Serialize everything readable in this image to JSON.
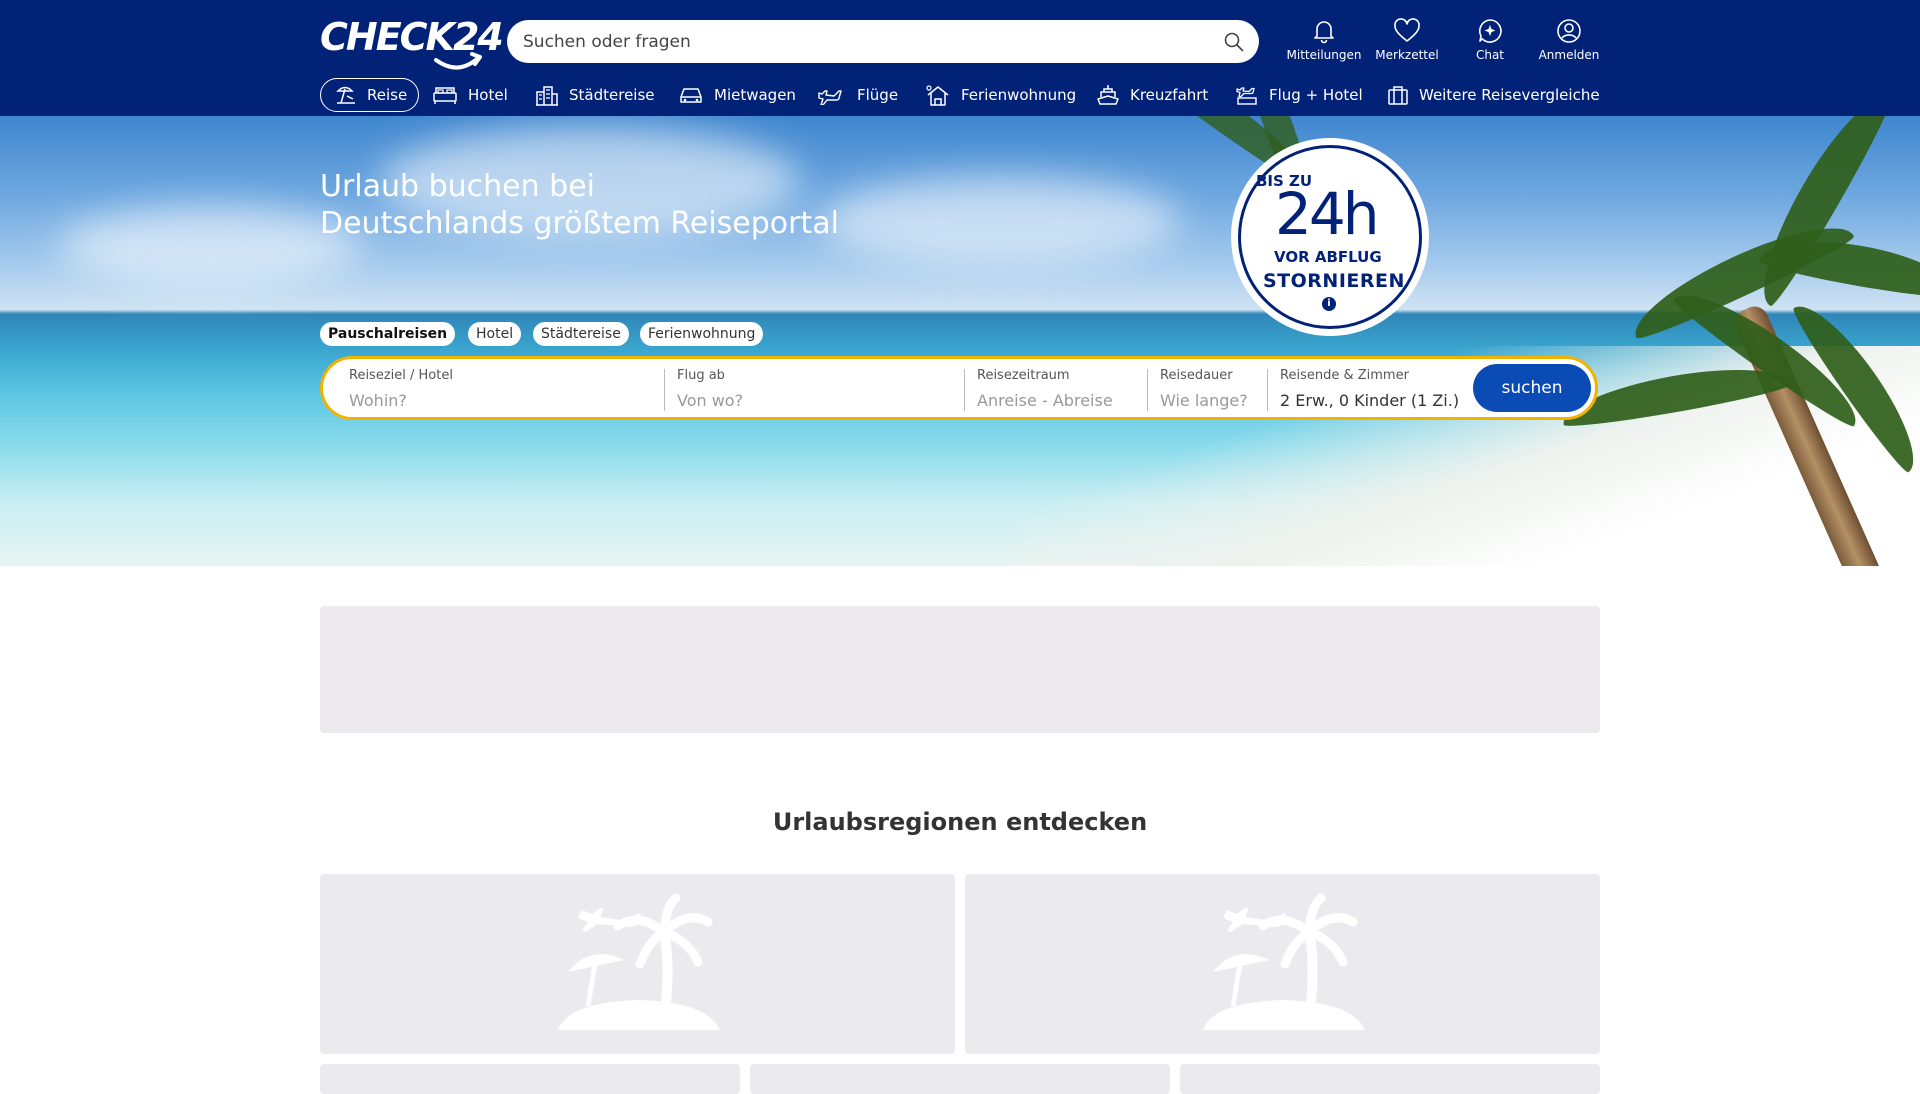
{
  "header": {
    "logo_text": "CHECK24",
    "search_placeholder": "Suchen oder fragen",
    "items": [
      {
        "label": "Mitteilungen",
        "icon": "bell-icon"
      },
      {
        "label": "Merkzettel",
        "icon": "heart-icon"
      },
      {
        "label": "Chat",
        "icon": "chat-icon"
      },
      {
        "label": "Anmelden",
        "icon": "user-icon"
      }
    ]
  },
  "nav": {
    "items": [
      {
        "label": "Reise",
        "icon": "beach-icon",
        "active": true
      },
      {
        "label": "Hotel",
        "icon": "bed-icon"
      },
      {
        "label": "Städtereise",
        "icon": "city-icon"
      },
      {
        "label": "Mietwagen",
        "icon": "car-icon"
      },
      {
        "label": "Flüge",
        "icon": "plane-icon"
      },
      {
        "label": "Ferienwohnung",
        "icon": "house-icon"
      },
      {
        "label": "Kreuzfahrt",
        "icon": "ship-icon"
      },
      {
        "label": "Flug + Hotel",
        "icon": "flight-hotel-icon"
      },
      {
        "label": "Weitere Reisevergleiche",
        "icon": "suitcase-icon"
      }
    ]
  },
  "hero": {
    "title_line1": "Urlaub buchen bei",
    "title_line2": "Deutschlands größtem Reiseportal",
    "badge": {
      "line1": "BIS ZU",
      "line2": "24h",
      "line3": "VOR ABFLUG",
      "line4": "STORNIEREN",
      "info": "i"
    },
    "tabs": [
      {
        "label": "Pauschalreisen",
        "active": true
      },
      {
        "label": "Hotel"
      },
      {
        "label": "Städtereise"
      },
      {
        "label": "Ferienwohnung"
      }
    ],
    "search": {
      "destination_label": "Reiseziel / Hotel",
      "destination_placeholder": "Wohin?",
      "departure_label": "Flug ab",
      "departure_placeholder": "Von wo?",
      "period_label": "Reisezeitraum",
      "period_start": "Anreise",
      "period_end": "- Abreise",
      "duration_label": "Reisedauer",
      "duration_placeholder": "Wie lange?",
      "travellers_label": "Reisende & Zimmer",
      "travellers_value": "2 Erw., 0 Kinder (1 Zi.)",
      "submit_label": "suchen"
    }
  },
  "regions": {
    "title": "Urlaubsregionen entdecken"
  },
  "colors": {
    "header_bg": "#022278",
    "search_border": "#f1b300",
    "button": "#0a4bb5",
    "placeholder_gray": "#ebebef"
  }
}
